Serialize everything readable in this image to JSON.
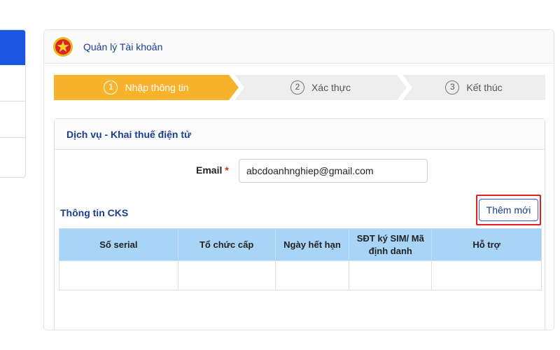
{
  "header": {
    "title": "Quản lý Tài khoản"
  },
  "stepper": {
    "steps": [
      {
        "number": "1",
        "label": "Nhập thông tin",
        "state": "active"
      },
      {
        "number": "2",
        "label": "Xác thực",
        "state": "inactive"
      },
      {
        "number": "3",
        "label": "Kết thúc",
        "state": "inactive"
      }
    ]
  },
  "service": {
    "title": "Dịch vụ - Khai thuế điện tử",
    "email_label": "Email",
    "required_mark": "*",
    "email_value": "abcdoanhnghiep@gmail.com"
  },
  "cks": {
    "title": "Thông tin CKS",
    "add_button_label": "Thêm mới",
    "columns": [
      "Số serial",
      "Tổ chức cấp",
      "Ngày hết hạn",
      "SĐT ký SIM/ Mã định danh",
      "Hỗ trợ"
    ],
    "rows": [
      [
        "",
        "",
        "",
        "",
        ""
      ]
    ]
  },
  "colors": {
    "active_step": "#f7b32b",
    "inactive_step": "#eeeeee",
    "table_header": "#a8d4f5",
    "title_blue": "#1a3d8f",
    "highlight_red": "#e02020",
    "sidebar_active": "#1a56e0"
  },
  "icons": {
    "emblem": "national-emblem-icon"
  }
}
